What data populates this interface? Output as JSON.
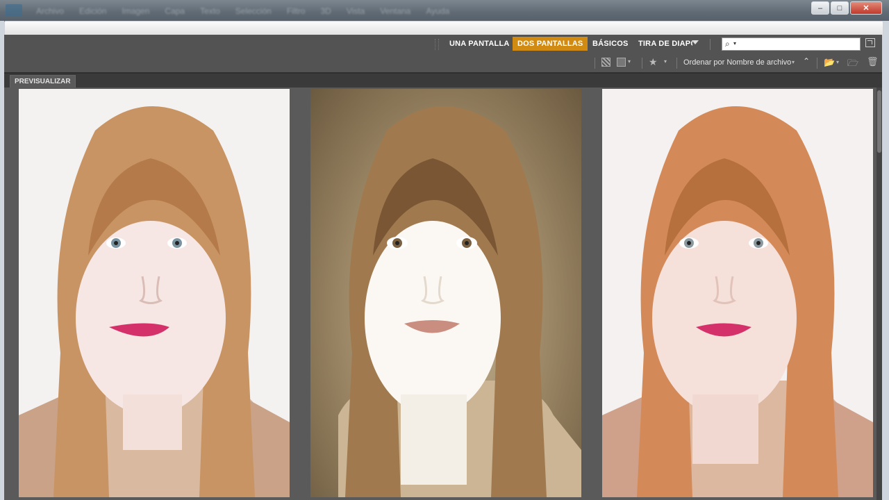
{
  "window": {
    "menu": [
      "Archivo",
      "Edición",
      "Imagen",
      "Capa",
      "Texto",
      "Selección",
      "Filtro",
      "3D",
      "Vista",
      "Ventana",
      "Ayuda"
    ],
    "controls": {
      "minimize": "–",
      "maximize": "□",
      "close": "✕"
    }
  },
  "workspaces": {
    "items": [
      {
        "label": "UNA PANTALLA",
        "active": false
      },
      {
        "label": "DOS PANTALLAS",
        "active": true
      },
      {
        "label": "BÁSICOS",
        "active": false
      },
      {
        "label": "TIRA DE DIAPOSITIVAS",
        "active": false
      }
    ],
    "active_color": "#d18b12",
    "search": {
      "placeholder": "",
      "value": ""
    }
  },
  "toolbar": {
    "sort_label": "Ordenar por Nombre de archivo",
    "icons": [
      "quality-icon",
      "thumbnails-icon",
      "star-filter-icon",
      "sort-ascending-icon",
      "open-folder-icon",
      "new-folder-icon",
      "trash-icon"
    ]
  },
  "panel": {
    "tab_label": "PREVISUALIZAR",
    "photos": [
      {
        "name": "photo-portrait-1",
        "style": "white background, natural skin, blue eyes, pink lips"
      },
      {
        "name": "photo-portrait-2",
        "style": "textured sepia background, pale skin, brown eyes"
      },
      {
        "name": "photo-portrait-3",
        "style": "white background, warm skin, pink lips"
      }
    ]
  }
}
